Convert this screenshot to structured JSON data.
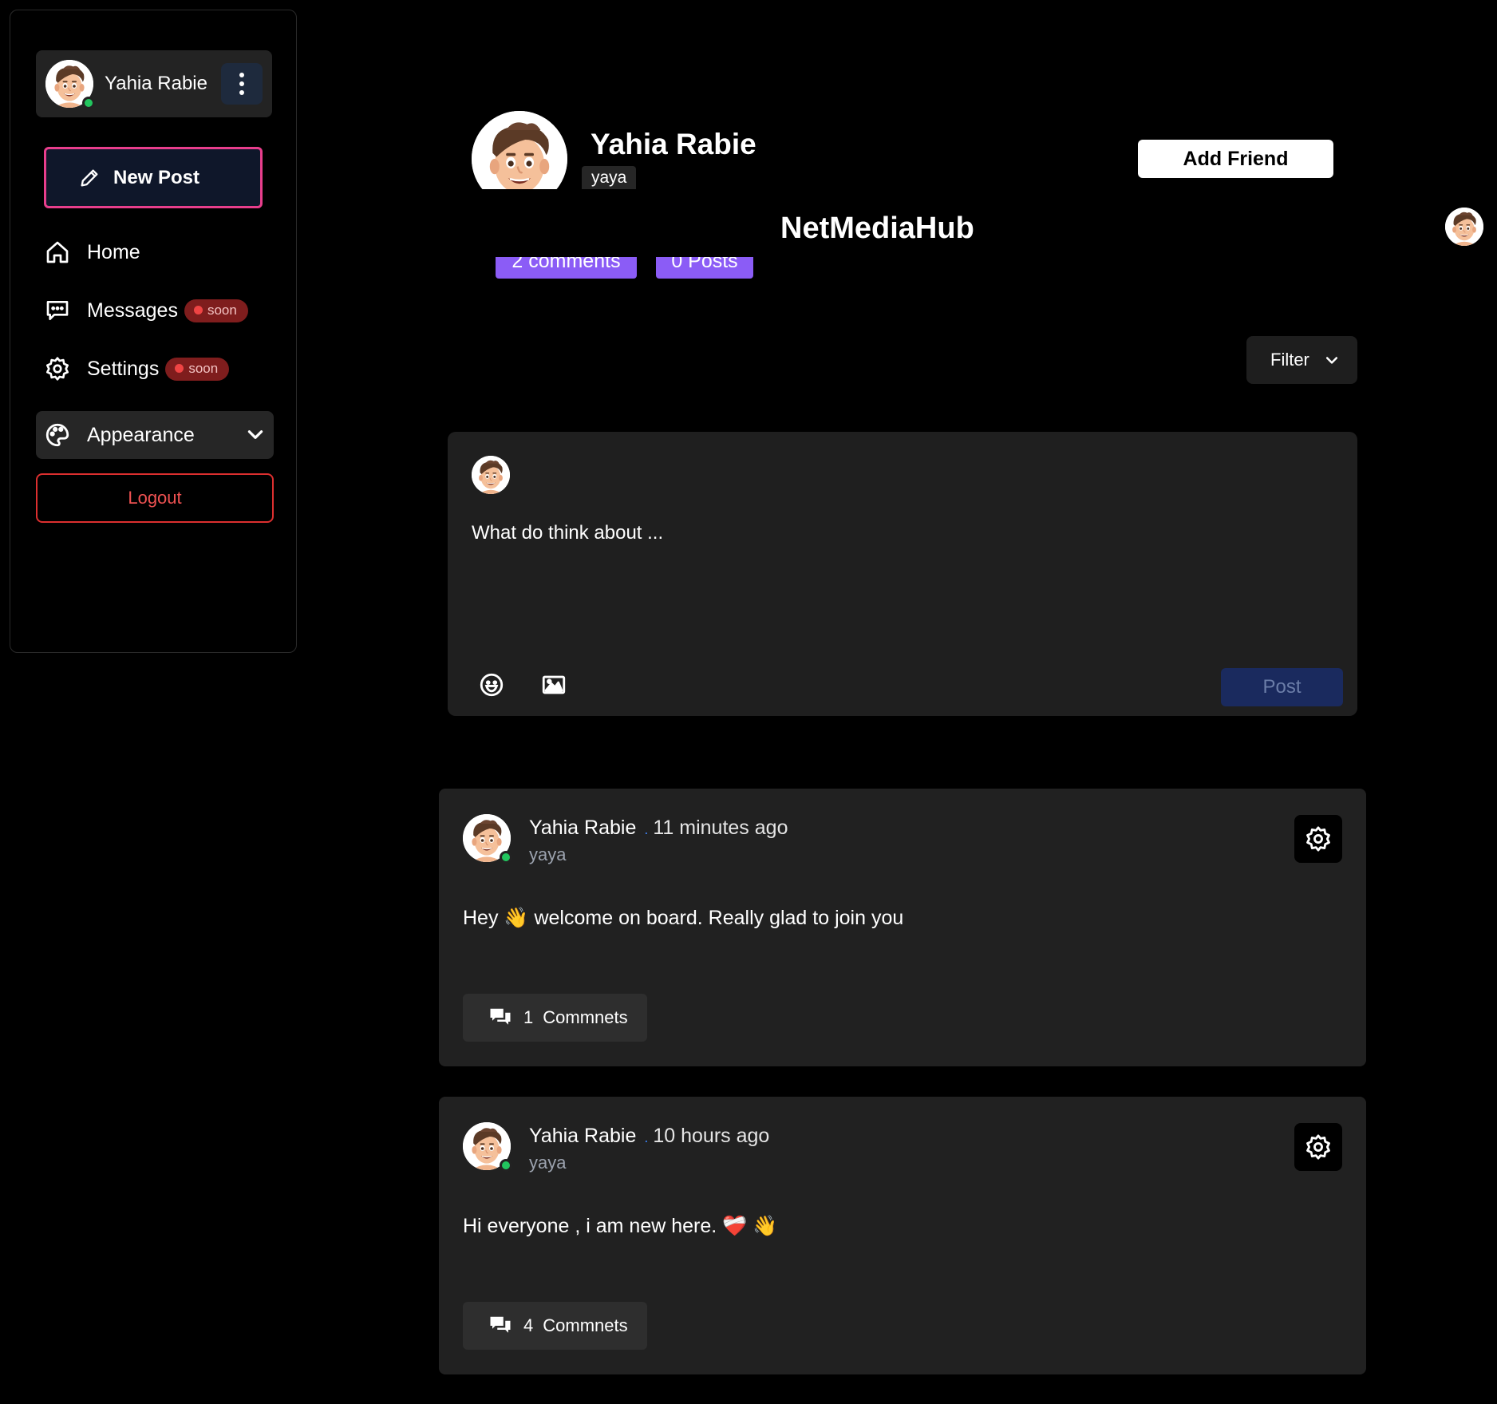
{
  "sidebar": {
    "user": {
      "name": "Yahia Rabie",
      "status": "online"
    },
    "new_post_label": "New Post",
    "nav": [
      {
        "label": "Home",
        "icon": "home-icon",
        "badge": ""
      },
      {
        "label": "Messages",
        "icon": "chat-icon",
        "badge": "soon"
      },
      {
        "label": "Settings",
        "icon": "gear-icon",
        "badge": "soon"
      }
    ],
    "appearance_label": "Appearance",
    "logout_label": "Logout"
  },
  "profile": {
    "name": "Yahia Rabie",
    "handle": "yaya",
    "add_friend_label": "Add Friend",
    "stats": {
      "comments": "2 comments",
      "posts": "0 Posts"
    }
  },
  "brand": "NetMediaHub",
  "filter_label": "Filter",
  "composer": {
    "placeholder": "What do think about ...",
    "post_label": "Post"
  },
  "posts": [
    {
      "author": "Yahia Rabie",
      "separator": ".",
      "time": "11 minutes ago",
      "handle": "yaya",
      "body": "Hey 👋 welcome on board. Really glad to join you",
      "comment_count": "1",
      "comment_label": "Commnets"
    },
    {
      "author": "Yahia Rabie",
      "separator": ".",
      "time": "10 hours ago",
      "handle": "yaya",
      "body": "Hi everyone , i am new here. ❤️‍🩹 👋",
      "comment_count": "4",
      "comment_label": "Commnets"
    }
  ],
  "colors": {
    "background": "#000000",
    "card": "#212121",
    "accent_purple": "#8b5cf6",
    "danger": "#dc2f2f",
    "online": "#22c55e",
    "post_button": "#1a2a5e"
  }
}
